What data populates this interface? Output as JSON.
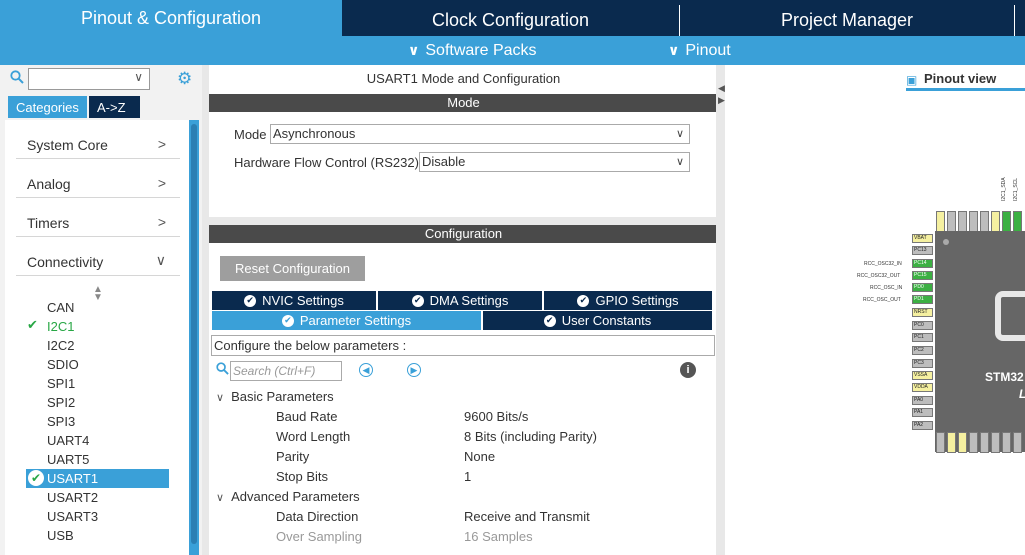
{
  "top_tabs": [
    "Pinout & Configuration",
    "Clock Configuration",
    "Project Manager"
  ],
  "sub_menu": [
    "Software Packs",
    "Pinout"
  ],
  "left": {
    "search_value": "",
    "category_tabs": [
      "Categories",
      "A->Z"
    ],
    "categories": [
      "System Core",
      "Analog",
      "Timers",
      "Connectivity"
    ],
    "peripherals": [
      "CAN",
      "I2C1",
      "I2C2",
      "SDIO",
      "SPI1",
      "SPI2",
      "SPI3",
      "UART4",
      "UART5",
      "USART1",
      "USART2",
      "USART3",
      "USB"
    ],
    "checked": [
      "I2C1"
    ],
    "selected": "USART1"
  },
  "mode_panel": {
    "title": "USART1 Mode and Configuration",
    "section": "Mode",
    "mode_label": "Mode",
    "mode_value": "Asynchronous",
    "flow_label": "Hardware Flow Control (RS232)",
    "flow_value": "Disable"
  },
  "config_panel": {
    "section": "Configuration",
    "reset_button": "Reset Configuration",
    "tabs_row1": [
      "NVIC Settings",
      "DMA Settings",
      "GPIO Settings"
    ],
    "tabs_row2": [
      "Parameter Settings",
      "User Constants"
    ],
    "hint": "Configure the below parameters :",
    "search_placeholder": "Search (Ctrl+F)",
    "groups": [
      {
        "name": "Basic Parameters",
        "params": [
          {
            "name": "Baud Rate",
            "value": "9600 Bits/s"
          },
          {
            "name": "Word Length",
            "value": "8 Bits (including Parity)"
          },
          {
            "name": "Parity",
            "value": "None"
          },
          {
            "name": "Stop Bits",
            "value": "1"
          }
        ]
      },
      {
        "name": "Advanced Parameters",
        "params": [
          {
            "name": "Data Direction",
            "value": "Receive and Transmit"
          },
          {
            "name": "Over Sampling",
            "value": "16 Samples"
          }
        ]
      }
    ]
  },
  "pinout": {
    "tab": "Pinout view",
    "chip_name": "STM32",
    "chip_pkg": "LC",
    "left_pins": [
      "VBAT",
      "PC13",
      "PC14",
      "PC15",
      "PD0",
      "PD1",
      "NRST",
      "PC0",
      "PC1",
      "PC2",
      "PC3",
      "VSSA",
      "VDDA",
      "PA0",
      "PA1",
      "PA2"
    ],
    "left_signals": [
      "RCC_OSC32_IN",
      "RCC_OSC32_OUT",
      "RCC_OSC_IN",
      "RCC_OSC_OUT"
    ],
    "top_signals": [
      "I2C1_SDA",
      "I2C1_SCL"
    ]
  }
}
